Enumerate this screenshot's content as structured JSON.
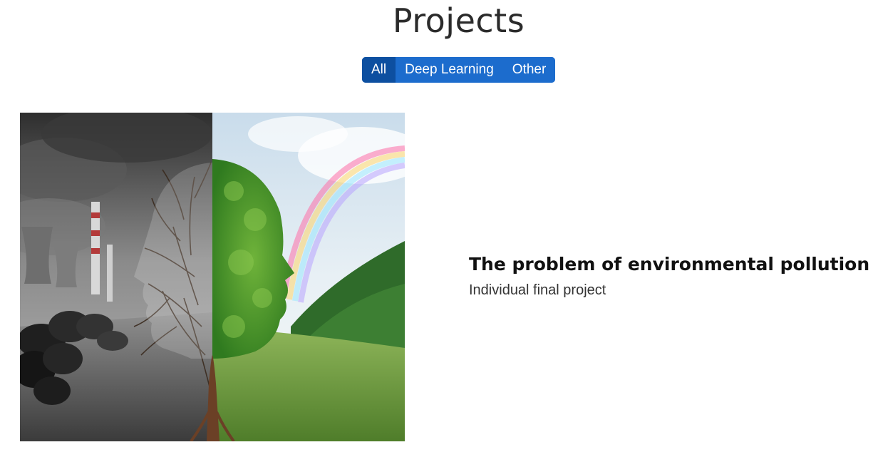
{
  "page": {
    "title": "Projects"
  },
  "filters": [
    {
      "label": "All",
      "active": true
    },
    {
      "label": "Deep Learning",
      "active": false
    },
    {
      "label": "Other",
      "active": false
    }
  ],
  "colors": {
    "filter_bg": "#1c6ccd",
    "filter_active_bg": "#0d4fa0"
  },
  "projects": [
    {
      "title": "The problem of environmental pollution",
      "subtitle": "Individual final project",
      "image_icon": "split-head-tree-illustration"
    }
  ]
}
